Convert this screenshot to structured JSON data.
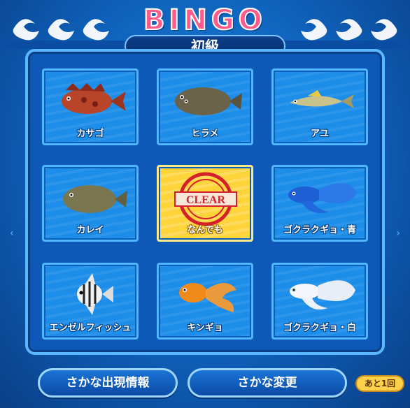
{
  "title": "BINGO",
  "level": "初級",
  "board": {
    "cells": [
      {
        "label": "カサゴ",
        "icon": "scorpionfish-icon",
        "state": "open"
      },
      {
        "label": "ヒラメ",
        "icon": "flounder-icon",
        "state": "open"
      },
      {
        "label": "アユ",
        "icon": "sweetfish-icon",
        "state": "open"
      },
      {
        "label": "カレイ",
        "icon": "flatfish-icon",
        "state": "open"
      },
      {
        "label": "なんでも",
        "icon": "clear-stamp-icon",
        "state": "cleared",
        "stamp_text": "CLEAR"
      },
      {
        "label": "ゴクラクギョ・青",
        "icon": "blue-paradise-fish-icon",
        "state": "open"
      },
      {
        "label": "エンゼルフィッシュ",
        "icon": "angelfish-icon",
        "state": "open"
      },
      {
        "label": "キンギョ",
        "icon": "goldfish-icon",
        "state": "open"
      },
      {
        "label": "ゴクラクギョ・白",
        "icon": "white-paradise-fish-icon",
        "state": "open"
      }
    ]
  },
  "buttons": {
    "fish_info": "さかな出現情報",
    "fish_change": "さかな変更",
    "remaining": "あと1回"
  },
  "colors": {
    "background": "#0e5fb8",
    "cell": "#1c8de8",
    "free_cell": "#ffd43a",
    "title_pink": "#ff5a8c",
    "stamp_red": "#d4202a"
  }
}
